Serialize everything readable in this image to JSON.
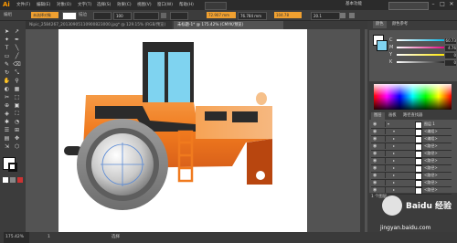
{
  "app": {
    "logo": "Ai"
  },
  "menu": [
    "文件(F)",
    "编辑(E)",
    "对象(O)",
    "文字(T)",
    "选择(S)",
    "效果(C)",
    "视图(V)",
    "窗口(W)",
    "帮助(H)"
  ],
  "workspace": "基本功能",
  "window_controls": [
    "–",
    "□",
    "✕"
  ],
  "control_bar": {
    "selection_label": "编组",
    "highlight_label": "未选择对象",
    "stroke_label": "描边",
    "opacity_value": "100",
    "x_value": "72.907 mm",
    "y_value": "76.784 mm",
    "w_value": "104.78",
    "h_value": "20.1"
  },
  "tabs": [
    {
      "label": "Nipic_2584267_20130905110900823000.jpg* @ 129.15% (RGB/预览)",
      "active": false
    },
    {
      "label": "未标题-1* @ 175.42% (CMYK/预览)",
      "active": true
    }
  ],
  "panels": {
    "color_tabs": [
      "颜色",
      "颜色参考"
    ],
    "sliders": [
      {
        "label": "C",
        "value": "60.73",
        "color": "#00b4e6"
      },
      {
        "label": "M",
        "value": "4.76",
        "color": "#e6007e"
      },
      {
        "label": "Y",
        "value": "0",
        "color": "#ffe600"
      },
      {
        "label": "K",
        "value": "0",
        "color": "#222222"
      }
    ],
    "layer_tabs": [
      "图层",
      "画板",
      "路径查找器"
    ],
    "layers": [
      {
        "name": "图层 1",
        "expanded": true
      },
      {
        "name": "<编组>",
        "expanded": true
      },
      {
        "name": "<编组>",
        "expanded": false
      },
      {
        "name": "<路径>",
        "expanded": false
      },
      {
        "name": "<路径>",
        "expanded": false
      },
      {
        "name": "<路径>",
        "expanded": false
      },
      {
        "name": "<路径>",
        "expanded": false
      },
      {
        "name": "<路径>",
        "expanded": false
      },
      {
        "name": "<路径>",
        "expanded": false
      },
      {
        "name": "<路径>",
        "expanded": false
      }
    ],
    "layers_footer": "1 个图层"
  },
  "status": {
    "zoom": "175.42%",
    "page": "1",
    "tool_label": "选择"
  },
  "watermark": {
    "line1": "Baidu 经验",
    "line2": "jingyan.baidu.com"
  },
  "colors": {
    "orange": "#f07a1e",
    "dark_orange": "#b8460f",
    "glass": "#7fd3f0",
    "accent": "#f0a030"
  }
}
